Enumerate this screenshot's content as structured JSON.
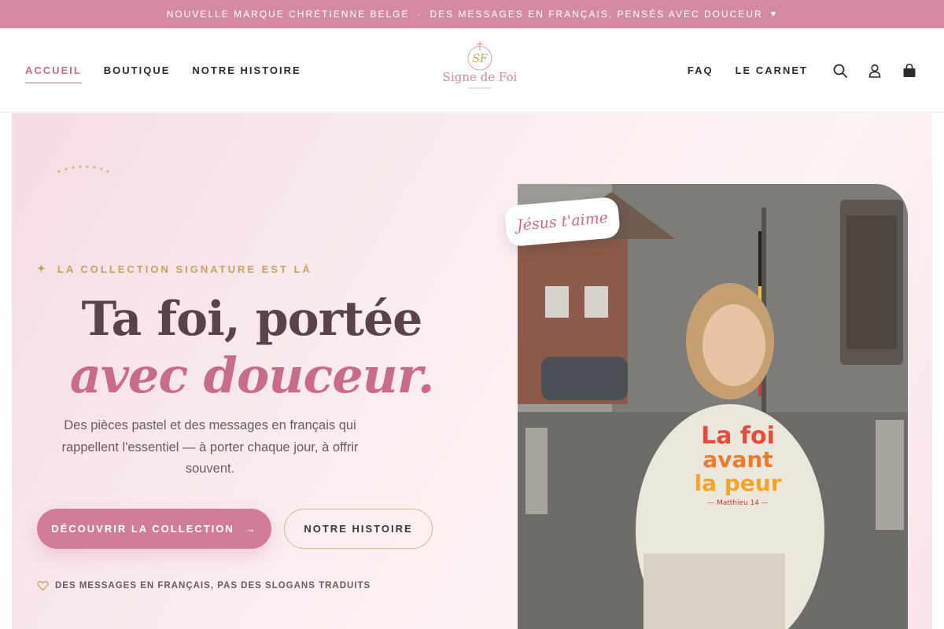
{
  "announcement": {
    "part1": "NOUVELLE MARQUE CHRÉTIENNE BELGE",
    "separator": "·",
    "part2": "DES MESSAGES EN FRANÇAIS, PENSÉS AVEC DOUCEUR",
    "heart": "♥"
  },
  "nav": {
    "left": [
      "ACCUEIL",
      "BOUTIQUE",
      "NOTRE HISTOIRE"
    ],
    "right": [
      "FAQ",
      "LE CARNET"
    ]
  },
  "logo": {
    "brand": "Signe de Foi",
    "monogram": "SF"
  },
  "icons": [
    "search-icon",
    "account-icon",
    "cart-icon"
  ],
  "hero": {
    "eyebrow_star": "✦",
    "eyebrow": "LA COLLECTION SIGNATURE EST LÀ",
    "headline_line1": "Ta foi, portée",
    "headline_line2": "avec douceur.",
    "subtitle": "Des pièces pastel et des messages en français qui rappellent l'essentiel — à porter chaque jour, à offrir souvent.",
    "primary_cta": "DÉCOUVRIR LA COLLECTION",
    "primary_arrow": "→",
    "secondary_cta": "NOTRE HISTOIRE",
    "note": "DES MESSAGES EN FRANÇAIS, PAS DES SLOGANS TRADUITS"
  },
  "photo": {
    "tag": "Jésus t'aime",
    "shirt_line1": "La foi",
    "shirt_line2": "avant",
    "shirt_line3": "la peur",
    "shirt_ref": "— Matthieu 14 —"
  },
  "colors": {
    "accent_pink": "#d27d98",
    "announcement_bg": "#d48aa1",
    "gold": "#c9a15e",
    "heading": "#5a4348"
  }
}
